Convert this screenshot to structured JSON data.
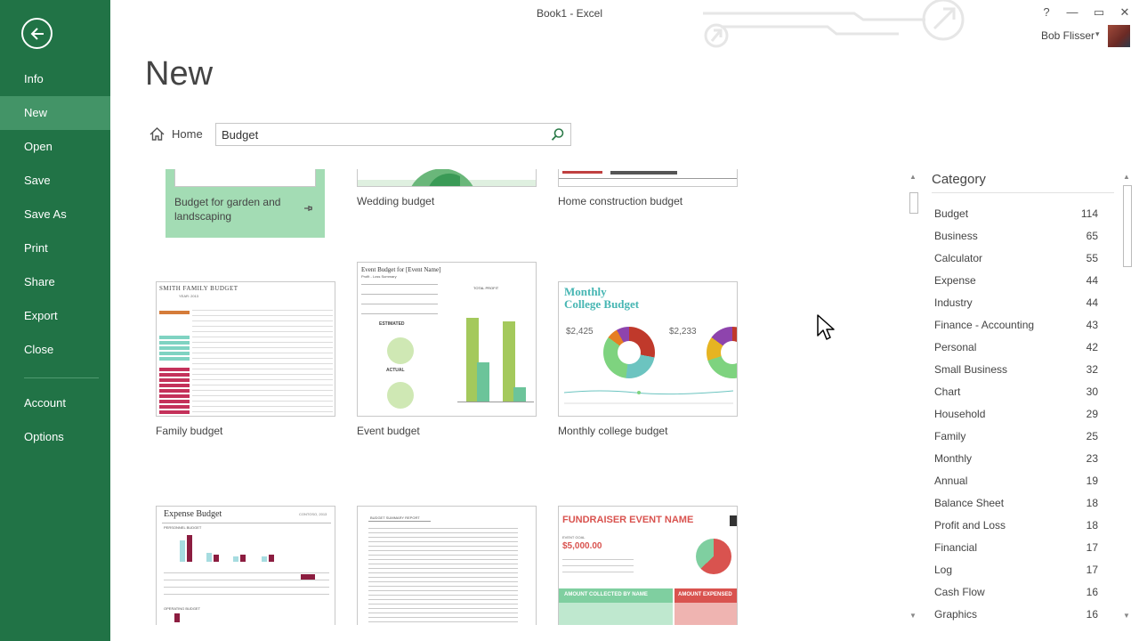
{
  "window": {
    "title": "Book1 - Excel",
    "help": "?",
    "minimize": "—",
    "restore": "▭",
    "close": "✕",
    "user_name": "Bob Flisser",
    "user_caret": "▾"
  },
  "sidebar": {
    "items": [
      {
        "label": "Info"
      },
      {
        "label": "New",
        "active": true
      },
      {
        "label": "Open"
      },
      {
        "label": "Save"
      },
      {
        "label": "Save As"
      },
      {
        "label": "Print"
      },
      {
        "label": "Share"
      },
      {
        "label": "Export"
      },
      {
        "label": "Close"
      },
      {
        "label": "Account"
      },
      {
        "label": "Options"
      }
    ]
  },
  "main": {
    "title": "New",
    "home_label": "Home",
    "search_value": "Budget"
  },
  "templates": [
    {
      "label": "Budget for garden and landscaping"
    },
    {
      "label": "Wedding budget"
    },
    {
      "label": "Home construction budget"
    },
    {
      "label": "Family budget",
      "thumb_title": "SMITH FAMILY BUDGET",
      "thumb_sub": "YEAR: 2013"
    },
    {
      "label": "Event budget",
      "thumb_title": "Event Budget for [Event Name]",
      "thumb_sub": "Profit - Loss Summary",
      "thumb_t1": "TOTAL PROFIT",
      "thumb_t2": "ESTIMATED",
      "thumb_t3": "ACTUAL"
    },
    {
      "label": "Monthly college budget",
      "thumb_title1": "Monthly",
      "thumb_title2": "College Budget",
      "thumb_v1": "$2,425",
      "thumb_v2": "$2,233"
    },
    {
      "label": "",
      "thumb_title": "Expense Budget",
      "thumb_brand": "CONTOSO, 2013",
      "thumb_sec1": "PERSONNEL BUDGET",
      "thumb_sec2": "OPERATING BUDGET"
    },
    {
      "label": "",
      "thumb_title": "BUDGET SUMMARY REPORT"
    },
    {
      "label": "",
      "thumb_title": "FUNDRAISER EVENT NAME",
      "thumb_goal_label": "EVENT GOAL",
      "thumb_goal": "$5,000.00",
      "thumb_band1": "AMOUNT COLLECTED BY NAME",
      "thumb_band2": "AMOUNT EXPENSED"
    }
  ],
  "category": {
    "heading": "Category",
    "items": [
      {
        "name": "Budget",
        "count": "114"
      },
      {
        "name": "Business",
        "count": "65"
      },
      {
        "name": "Calculator",
        "count": "55"
      },
      {
        "name": "Expense",
        "count": "44"
      },
      {
        "name": "Industry",
        "count": "44"
      },
      {
        "name": "Finance - Accounting",
        "count": "43"
      },
      {
        "name": "Personal",
        "count": "42"
      },
      {
        "name": "Small Business",
        "count": "32"
      },
      {
        "name": "Chart",
        "count": "30"
      },
      {
        "name": "Household",
        "count": "29"
      },
      {
        "name": "Family",
        "count": "25"
      },
      {
        "name": "Monthly",
        "count": "23"
      },
      {
        "name": "Annual",
        "count": "19"
      },
      {
        "name": "Balance Sheet",
        "count": "18"
      },
      {
        "name": "Profit and Loss",
        "count": "18"
      },
      {
        "name": "Financial",
        "count": "17"
      },
      {
        "name": "Log",
        "count": "17"
      },
      {
        "name": "Cash Flow",
        "count": "16"
      },
      {
        "name": "Graphics",
        "count": "16"
      }
    ]
  },
  "colors": {
    "sidebar": "#217346",
    "sidebar_active": "#439467",
    "garden_tile": "#a3dcb4"
  }
}
